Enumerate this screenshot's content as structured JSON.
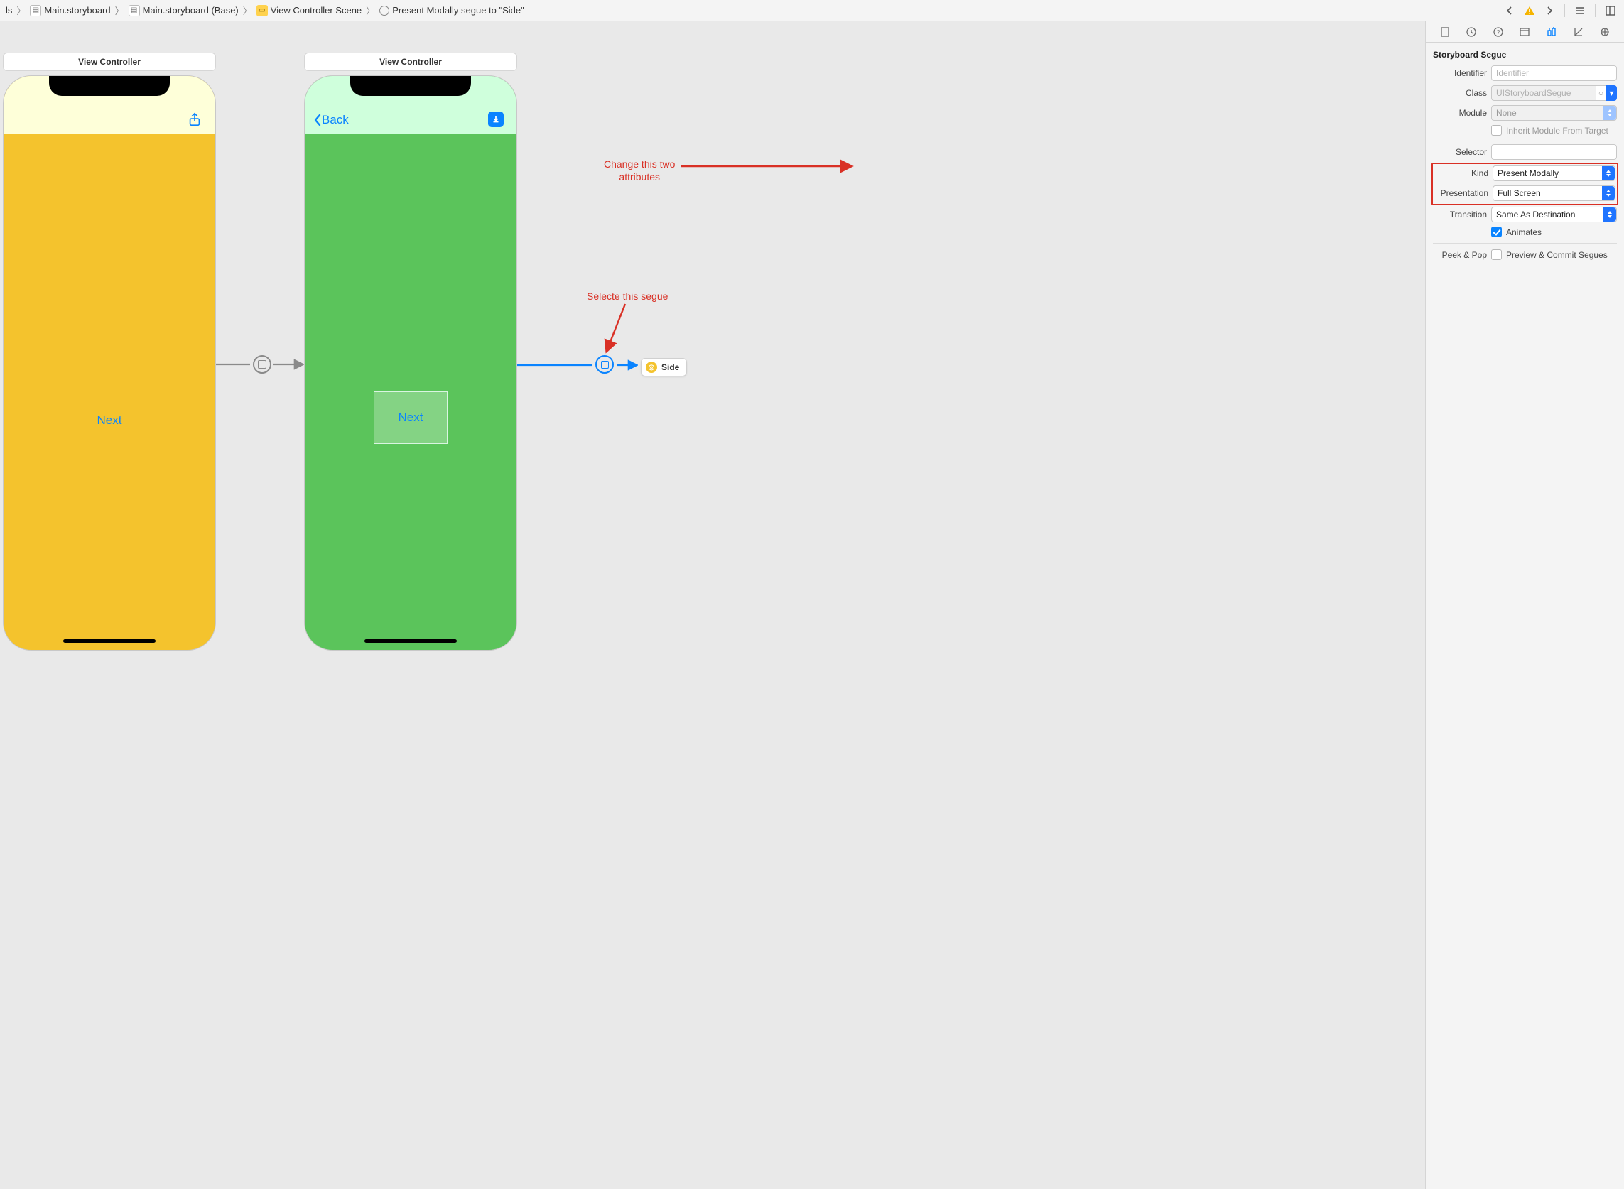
{
  "breadcrumbs": {
    "root": "ls",
    "items": [
      {
        "label": "Main.storyboard"
      },
      {
        "label": "Main.storyboard (Base)"
      },
      {
        "label": "View Controller Scene"
      },
      {
        "label": "Present Modally segue to \"Side\""
      }
    ]
  },
  "canvas": {
    "vc1": {
      "title": "View Controller",
      "next": "Next"
    },
    "vc2": {
      "title": "View Controller",
      "back": "Back",
      "next": "Next"
    },
    "scene_ref": {
      "label": "Side"
    },
    "annotations": {
      "segue_hint": "Selecte this segue",
      "attr_hint": "Change this two\nattributes"
    }
  },
  "inspector": {
    "section": "Storyboard Segue",
    "labels": {
      "identifier": "Identifier",
      "class": "Class",
      "module": "Module",
      "inherit": "Inherit Module From Target",
      "selector": "Selector",
      "kind": "Kind",
      "presentation": "Presentation",
      "transition": "Transition",
      "animates": "Animates",
      "peekpop": "Peek & Pop",
      "preview": "Preview & Commit Segues"
    },
    "placeholders": {
      "identifier": "Identifier",
      "class": "UIStoryboardSegue",
      "module": "None"
    },
    "values": {
      "identifier": "",
      "kind": "Present Modally",
      "presentation": "Full Screen",
      "transition": "Same As Destination",
      "animates_checked": true,
      "inherit_checked": false,
      "preview_checked": false
    }
  }
}
